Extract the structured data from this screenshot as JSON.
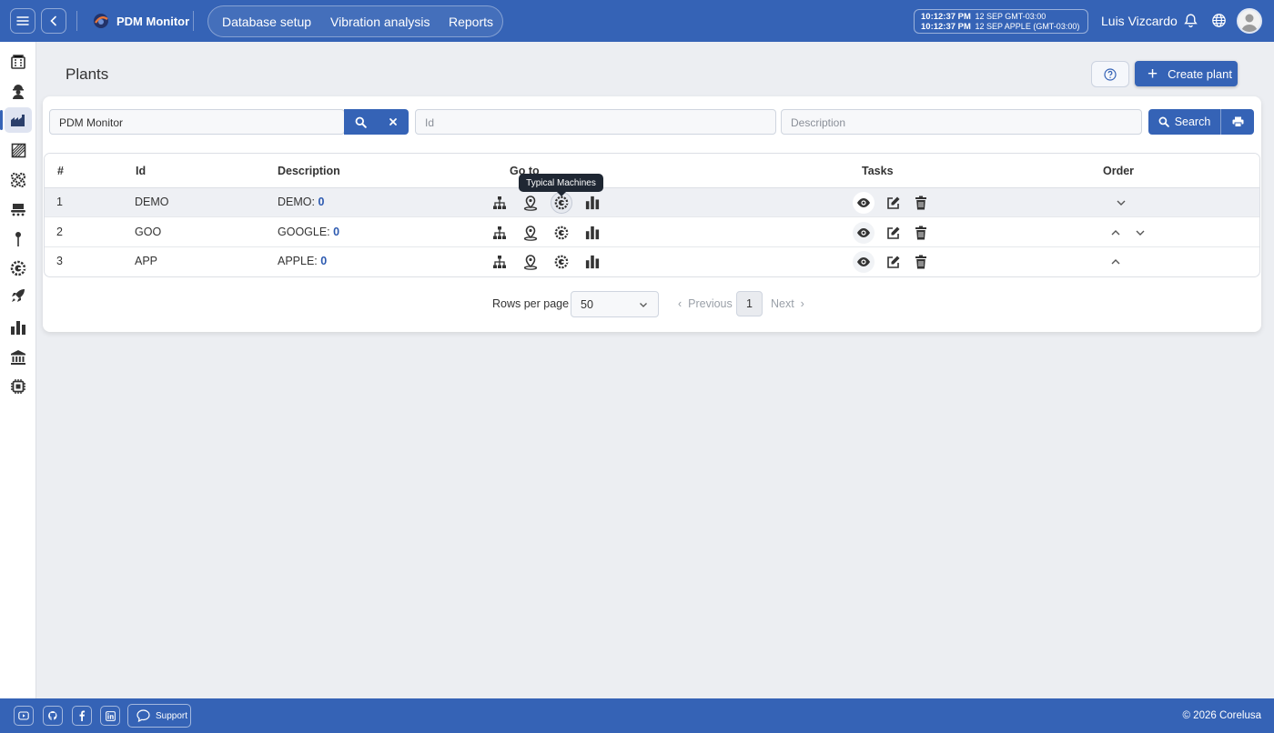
{
  "app": {
    "title": "PDM Monitor"
  },
  "nav": {
    "items": [
      "Database setup",
      "Vibration analysis",
      "Reports"
    ]
  },
  "clock": {
    "line1_time": "10:12:37 PM",
    "line1_info": "12 SEP  GMT-03:00",
    "line2_time": "10:12:37 PM",
    "line2_info": "12 SEP  APPLE (GMT-03:00)"
  },
  "user": {
    "name": "Luis Vizcardo"
  },
  "sidebar": {
    "items": [
      "buildings-icon",
      "worker-icon",
      "factory-icon",
      "area-icon",
      "machines-icon",
      "conveyor-icon",
      "sensor-pin-icon",
      "typical-machines-icon",
      "rocket-icon",
      "chart-icon",
      "institution-icon",
      "chip-icon"
    ],
    "active": "factory-icon"
  },
  "page": {
    "title": "Plants",
    "create_label": "Create plant"
  },
  "filters": {
    "plant_value": "PDM Monitor",
    "id_placeholder": "Id",
    "description_placeholder": "Description",
    "search_label": "Search"
  },
  "table": {
    "headers": {
      "num": "#",
      "id": "Id",
      "description": "Description",
      "goto": "Go to",
      "tasks": "Tasks",
      "order": "Order"
    },
    "rows": [
      {
        "num": "1",
        "id": "DEMO",
        "desc": "DEMO:",
        "count": "0"
      },
      {
        "num": "2",
        "id": "GOO",
        "desc": "GOOGLE:",
        "count": "0"
      },
      {
        "num": "3",
        "id": "APP",
        "desc": "APPLE:",
        "count": "0"
      }
    ]
  },
  "tooltip": {
    "text": "Typical Machines"
  },
  "pagination": {
    "rows_label": "Rows per page",
    "rows_value": "50",
    "previous": "Previous",
    "current": "1",
    "next": "Next"
  },
  "footer": {
    "support_label": "Support",
    "copyright": "© 2026 Corelusa"
  },
  "colors": {
    "primary": "#3563b6",
    "background": "#eceef2",
    "link": "#2d5ab0"
  }
}
